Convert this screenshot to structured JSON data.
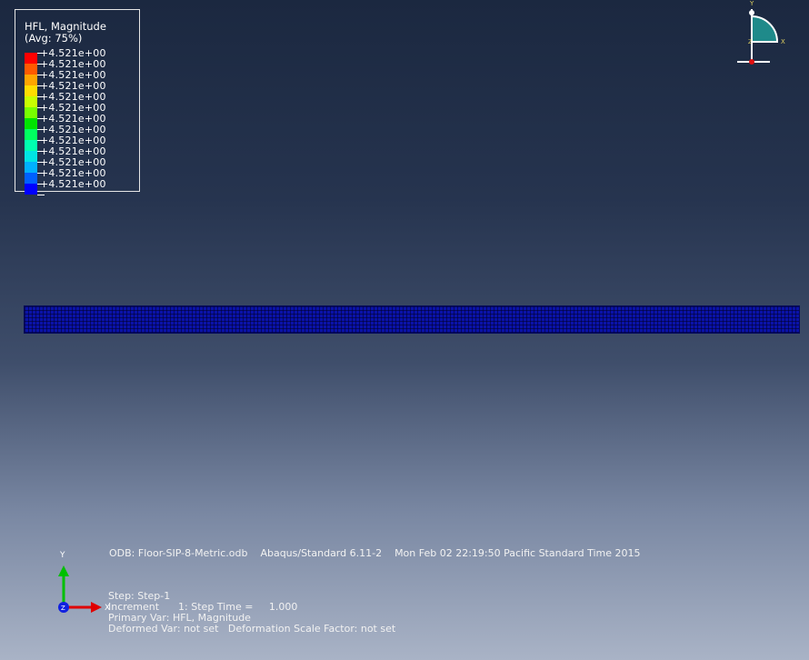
{
  "legend": {
    "title": "HFL, Magnitude",
    "subtitle": "(Avg: 75%)",
    "colors": [
      "#ff0000",
      "#ff5a00",
      "#ffa500",
      "#ffdd00",
      "#c8ff00",
      "#78ff00",
      "#00e400",
      "#00ff60",
      "#00ffb0",
      "#00e4e4",
      "#00b0ff",
      "#0060ff",
      "#0000ff"
    ],
    "values": [
      "+4.521e+00",
      "+4.521e+00",
      "+4.521e+00",
      "+4.521e+00",
      "+4.521e+00",
      "+4.521e+00",
      "+4.521e+00",
      "+4.521e+00",
      "+4.521e+00",
      "+4.521e+00",
      "+4.521e+00",
      "+4.521e+00",
      "+4.521e+00"
    ]
  },
  "triad_top_right": {
    "y_label": "Y",
    "x_label": "X",
    "z_label": "Z"
  },
  "triad_bottom_left": {
    "y_label": "Y",
    "x_label": "X",
    "z_label": "Z"
  },
  "info": {
    "odb_line": "ODB: Floor-SIP-8-Metric.odb    Abaqus/Standard 6.11-2    Mon Feb 02 22:19:50 Pacific Standard Time 2015",
    "step_line": "Step: Step-1",
    "increment_line": "Increment      1: Step Time =     1.000",
    "primary_var_line": "Primary Var: HFL, Magnitude",
    "deformed_var_line": "Deformed Var: not set   Deformation Scale Factor: not set"
  }
}
